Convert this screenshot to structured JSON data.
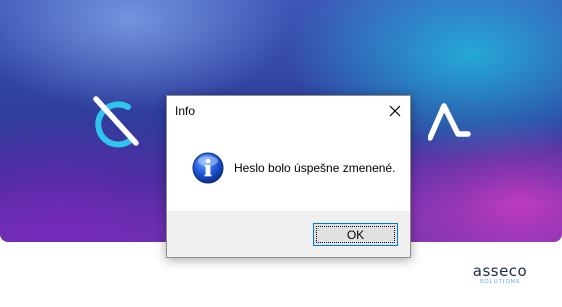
{
  "background": {
    "brand_name": "asseco",
    "brand_sub": "SOLUTIONS",
    "left_logo_icon": "q-logo-icon",
    "right_logo_icon": "a-logo-icon"
  },
  "dialog": {
    "title": "Info",
    "message": "Heslo bolo úspešne zmenené.",
    "ok_label": "OK",
    "icon": "info-icon",
    "close_icon": "close-icon"
  },
  "colors": {
    "accent_blue": "#0078d7",
    "brand_dark": "#1d2b46",
    "brand_light": "#4aa8d8"
  }
}
